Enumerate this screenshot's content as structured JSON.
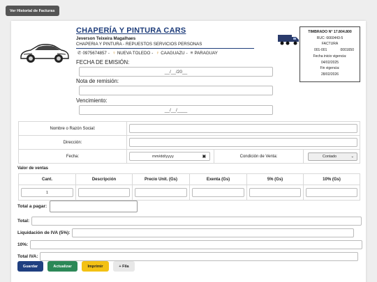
{
  "toolbar": {
    "history_label": "Ver Historial de Facturas"
  },
  "header": {
    "brand": "CHAPERÍA Y PINTURA CARS",
    "owner": "Jeverson Teixeira Magalhaes",
    "activity": "CHAPERIA Y PINTURA - REPUESTOS SERVICIOS PERSONAS",
    "phone": "0975674857",
    "city1": "NUEVA TOLEDO",
    "city2": "CAAGUAZU",
    "country": "PARAGUAY",
    "icons": [
      "car-icon",
      "truck-icon",
      "phone-icon",
      "map-pin-icon",
      "flag-icon"
    ]
  },
  "timbrado": {
    "title": "TIMBRADO N° 17.804.800",
    "ruc": "RUC: 6660443-5",
    "doc_type": "FACTURA",
    "series": "001-001",
    "number": "0001650",
    "start_label": "Fecha inicio vigencia:",
    "start_date": "04/02/2025",
    "end_label": "Fin vigencia:",
    "end_date": "28/02/2026"
  },
  "header_fields": {
    "emission_label": "FECHA DE EMISIÓN:",
    "emission_value": "__/__/20__",
    "remision_label": "Nota de remisión:",
    "remision_value": "",
    "due_label": "Vencimiento:",
    "due_value": "__/__/____"
  },
  "client": {
    "name_label": "Nombre o Razón Social:",
    "address_label": "Dirección:",
    "date_label": "Fecha:",
    "date_placeholder": "mm/dd/yyyy",
    "condition_label": "Condición de Venta:",
    "condition_value": "Contado"
  },
  "sales": {
    "title": "Valor de ventas",
    "columns": [
      "Cant.",
      "Descripción",
      "Precio Unit. (Gs)",
      "Exenta (Gs)",
      "5% (Gs)",
      "10% (Gs)"
    ],
    "rows": [
      {
        "qty": "1",
        "description": "",
        "unit_price": "",
        "exenta": "",
        "iva5": "",
        "iva10": ""
      }
    ]
  },
  "totals": {
    "total_pagar_label": "Total a pagar:",
    "total_label": "Total:",
    "liquidacion_label": "Liquidación de IVA (5%):",
    "diez_label": "10%:",
    "total_iva_label": "Total IVA:"
  },
  "actions": {
    "save_label": "Guardar",
    "update_label": "Actualizar",
    "print_label": "Imprimir",
    "add_row_label": "+ Fila"
  },
  "colors": {
    "primary": "#1f3f80",
    "success": "#2c8857",
    "warning": "#f3c114",
    "neutral": "#e8e8e8",
    "history_button": "#555555"
  }
}
